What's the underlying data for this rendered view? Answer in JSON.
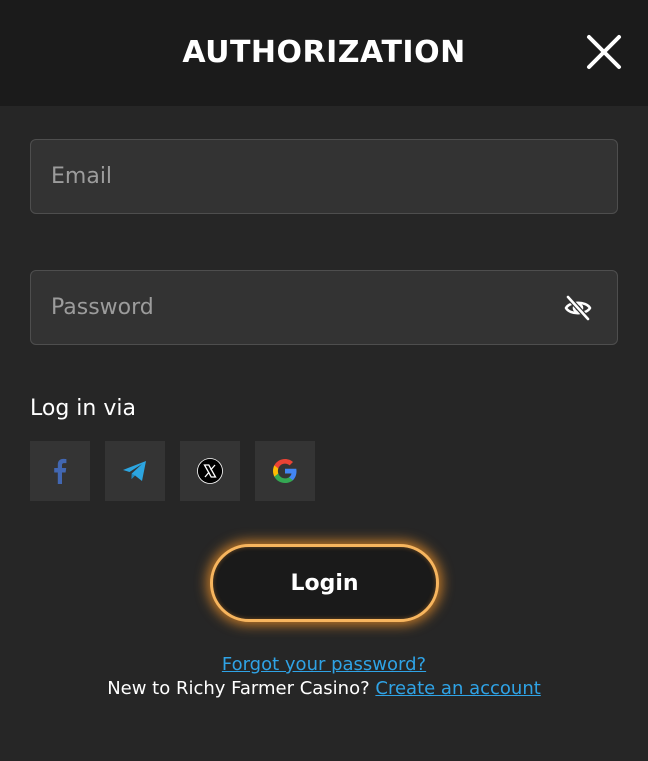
{
  "header": {
    "title": "AUTHORIZATION",
    "close_icon": "close-icon"
  },
  "form": {
    "email": {
      "placeholder": "Email",
      "value": ""
    },
    "password": {
      "placeholder": "Password",
      "value": "",
      "toggle_icon": "eye-off-icon"
    }
  },
  "social": {
    "label": "Log in via",
    "providers": [
      {
        "name": "facebook",
        "icon": "facebook-icon",
        "color": "#4267b2"
      },
      {
        "name": "telegram",
        "icon": "telegram-icon",
        "color": "#2ca5e0"
      },
      {
        "name": "x",
        "icon": "x-icon",
        "color": "#000000"
      },
      {
        "name": "google",
        "icon": "google-icon",
        "color": "#4285f4"
      }
    ]
  },
  "actions": {
    "login_label": "Login",
    "forgot_password": "Forgot your password?",
    "signup_prompt": "New to Richy Farmer Casino?",
    "signup_link": "Create an account"
  },
  "colors": {
    "background": "#262626",
    "header": "#1b1b1b",
    "accent": "#f7b55e",
    "link": "#2fa3e6"
  }
}
